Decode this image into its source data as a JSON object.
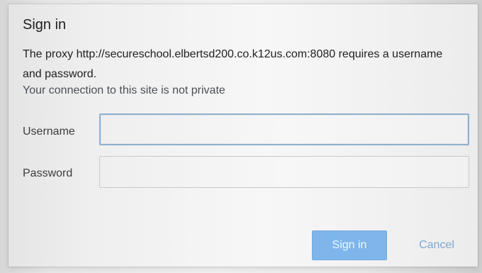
{
  "dialog": {
    "title": "Sign in",
    "message": "The proxy http://secureschool.elbertsd200.co.k12us.com:8080 requires a username and password.",
    "warning": "Your connection to this site is not private"
  },
  "fields": {
    "username_label": "Username",
    "username_value": "",
    "password_label": "Password",
    "password_value": ""
  },
  "actions": {
    "sign_in_label": "Sign in",
    "cancel_label": "Cancel"
  },
  "colors": {
    "accent": "#7eb6ec",
    "text": "#202124",
    "muted": "#4b4f57"
  }
}
